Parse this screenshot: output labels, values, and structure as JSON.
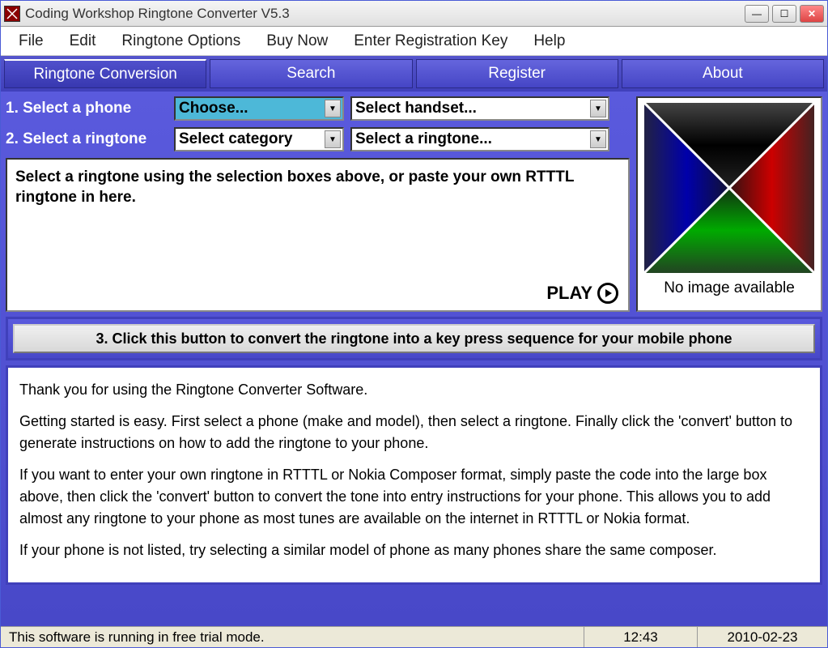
{
  "window": {
    "title": "Coding Workshop Ringtone Converter V5.3"
  },
  "menu": {
    "items": [
      "File",
      "Edit",
      "Ringtone Options",
      "Buy Now",
      "Enter Registration Key",
      "Help"
    ]
  },
  "tabs": {
    "items": [
      "Ringtone Conversion",
      "Search",
      "Register",
      "About"
    ],
    "active": 0
  },
  "controls": {
    "row1_label": "1. Select a phone",
    "row1_dd1": "Choose...",
    "row1_dd2": "Select handset...",
    "row2_label": "2. Select a ringtone",
    "row2_dd1": "Select category",
    "row2_dd2": "Select a ringtone..."
  },
  "textarea": {
    "placeholder": "Select a ringtone using the selection boxes above,  or paste your own RTTTL ringtone in here.",
    "play_label": "PLAY"
  },
  "right_panel": {
    "no_image": "No image available"
  },
  "convert": {
    "button": "3. Click this button to convert the ringtone into a key press sequence for your mobile phone"
  },
  "info": {
    "p1": "Thank you for using the Ringtone Converter Software.",
    "p2": "Getting started is easy.  First select a phone (make and model),  then select a ringtone.  Finally click the 'convert' button to generate instructions on how to add the ringtone to your phone.",
    "p3": "If you want to enter your own ringtone in RTTTL or Nokia Composer format, simply paste the code into the large box above,  then click the 'convert' button to convert the tone into entry instructions for your phone.  This allows you to add almost any ringtone to your phone as most tunes are available on the internet in RTTTL or Nokia format.",
    "p4": "If your phone is not listed,  try selecting a similar model of phone as many phones share the same composer."
  },
  "status": {
    "message": "This software is running in free trial mode.",
    "time": "12:43",
    "date": "2010-02-23"
  }
}
